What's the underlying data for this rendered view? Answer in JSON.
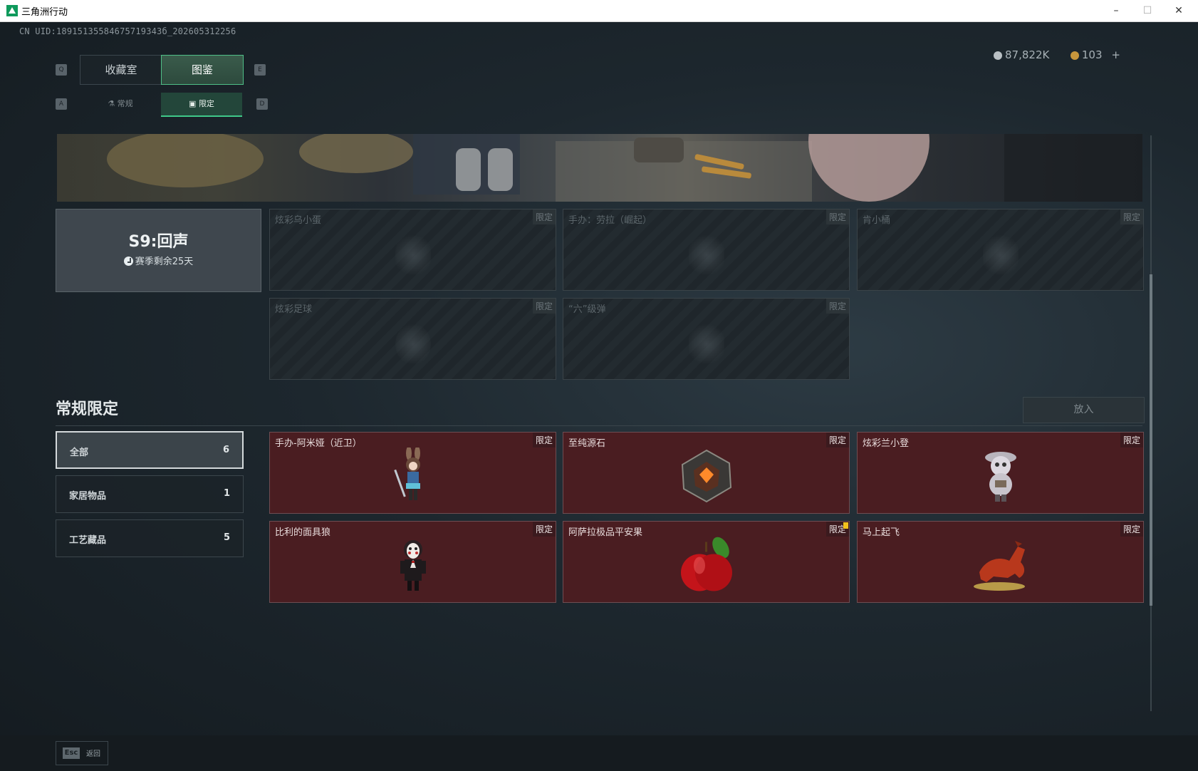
{
  "window": {
    "title": "三角洲行动",
    "minimize": "–",
    "maximize": "☐",
    "close": "✕"
  },
  "uid": "CN UID:18915135584675719343б_202605312256",
  "currency": {
    "silver": "87,822K",
    "gold": "103",
    "add": "+",
    "silver_color": "#b9c0c4",
    "gold_color": "#c8963c"
  },
  "tabs": {
    "prev_key": "Q",
    "next_key": "E",
    "collection": "收藏室",
    "catalog": "图鉴"
  },
  "subtabs": {
    "prev_key": "A",
    "next_key": "D",
    "normal": "常规",
    "limited": "限定",
    "normal_icon": "flask-icon",
    "limited_icon": "image-icon"
  },
  "season": {
    "title": "S9:回声",
    "remaining": "赛季剩余25天",
    "icon": "clock-icon"
  },
  "locked_items": [
    {
      "name": "炫彩乌小蛋",
      "tag": "限定"
    },
    {
      "name": "手办：劳拉（崛起）",
      "tag": "限定"
    },
    {
      "name": "肯小桶",
      "tag": "限定"
    },
    {
      "name": "炫彩足球",
      "tag": "限定"
    },
    {
      "name": "“六”级弹",
      "tag": "限定"
    }
  ],
  "section": {
    "title": "常规限定",
    "put_in": "放入"
  },
  "categories": [
    {
      "label": "全部",
      "count": "6"
    },
    {
      "label": "家居物品",
      "count": "1"
    },
    {
      "label": "工艺藏品",
      "count": "5"
    }
  ],
  "owned_items": [
    {
      "name": "手办-阿米娅（近卫）",
      "tag": "限定",
      "icon": "figurine-amiya-icon"
    },
    {
      "name": "至纯源石",
      "tag": "限定",
      "icon": "crystal-icon"
    },
    {
      "name": "炫彩兰小登",
      "tag": "限定",
      "icon": "plush-figure-icon"
    },
    {
      "name": "比利的面具狼",
      "tag": "限定",
      "icon": "puppet-billy-icon"
    },
    {
      "name": "阿萨拉极品平安果",
      "tag": "限定",
      "icon": "apple-icon"
    },
    {
      "name": "马上起飞",
      "tag": "限定",
      "icon": "horse-statue-icon"
    }
  ],
  "footer": {
    "esc": "Esc",
    "back": "返回"
  }
}
